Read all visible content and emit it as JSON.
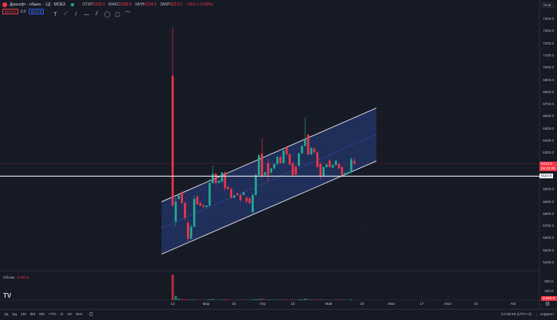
{
  "header": {
    "symbol": "Диасофт - обыкн. · 1Д · MOEX",
    "ohlc": {
      "o_label": "ОТКР",
      "o": "6235.0",
      "h_label": "МАКС",
      "h": "6269.5",
      "l_label": "МИН",
      "l": "6194.5",
      "c_label": "ЗАКР",
      "c": "6213.5",
      "change": "−39.5 (−0.63%)"
    },
    "bid": "6213.5",
    "spread": "0.0",
    "ask": "6213.5"
  },
  "toolbar": {
    "tools": [
      "text-tool",
      "brush-tool",
      "trend-line-tool",
      "horizontal-ray-tool",
      "parallel-channel-tool",
      "ellipse-tool",
      "rectangle-tool",
      "path-tool"
    ],
    "glyphs": [
      "T",
      "⟋",
      "/",
      "—",
      "⫽",
      "◯",
      "▢",
      "⌒"
    ]
  },
  "currency": "RUB",
  "price_axis": [
    "7400.0",
    "7300.0",
    "7200.0",
    "7100.0",
    "7000.0",
    "6900.0",
    "6800.0",
    "6700.0",
    "6600.0",
    "6500.0",
    "6400.0",
    "6300.0",
    "6000.0",
    "5900.0",
    "5800.0",
    "5700.0",
    "5600.0",
    "5500.0",
    "5400.0"
  ],
  "price_values": [
    7400,
    7300,
    7200,
    7100,
    7000,
    6900,
    6800,
    6700,
    6600,
    6500,
    6400,
    6300,
    6000,
    5900,
    5800,
    5700,
    5600,
    5500,
    5400
  ],
  "last_price": {
    "value": "6213.5",
    "countdown": "05:10:29"
  },
  "hline": {
    "label": "6110.5",
    "value": 6110.5
  },
  "volume": {
    "label": "Объём",
    "value": "3.203 K",
    "axis": [
      "800 K",
      "400 K"
    ],
    "last": "3.203 K"
  },
  "time_axis": [
    "13",
    "Мар",
    "18",
    "Апр",
    "15",
    "Май",
    "20",
    "Июн",
    "17",
    "Июл",
    "15",
    "Авг"
  ],
  "bottom": {
    "ranges": [
      "1д",
      "5д",
      "1М",
      "3М",
      "6М",
      "YTD",
      "1г",
      "5л",
      "Все"
    ],
    "clock": "13:49:29 (UTC+3)",
    "adjust": "коррект."
  },
  "colors": {
    "up": "#22ab94",
    "down": "#f23645",
    "channel": "#2a3f86"
  },
  "chart_data": {
    "type": "candlestick",
    "candles": [
      [
        6936,
        7330,
        5860,
        5869
      ],
      [
        5738,
        5935,
        5700,
        5902
      ],
      [
        5924,
        5960,
        5915,
        5950
      ],
      [
        5978,
        5990,
        5880,
        5891
      ],
      [
        5891,
        5900,
        5750,
        5767
      ],
      [
        5728,
        5745,
        5560,
        5597
      ],
      [
        5597,
        5710,
        5590,
        5695
      ],
      [
        5695,
        5950,
        5690,
        5924
      ],
      [
        5941,
        5955,
        5875,
        5880
      ],
      [
        5891,
        5900,
        5860,
        5869
      ],
      [
        5869,
        5880,
        5850,
        5858
      ],
      [
        5858,
        5875,
        5850,
        5869
      ],
      [
        5869,
        6090,
        5860,
        6054
      ],
      [
        6054,
        6200,
        6050,
        6130
      ],
      [
        6130,
        6140,
        6040,
        6054
      ],
      [
        6054,
        6080,
        6050,
        6072
      ],
      [
        6065,
        6145,
        6060,
        6141
      ],
      [
        6141,
        6150,
        5990,
        6011
      ],
      [
        6022,
        6030,
        5995,
        6006
      ],
      [
        6006,
        6015,
        5925,
        5934
      ],
      [
        5934,
        5960,
        5930,
        5952
      ],
      [
        5967,
        5980,
        5950,
        5956
      ],
      [
        5956,
        5965,
        5900,
        5913
      ],
      [
        5956,
        5985,
        5950,
        5978
      ],
      [
        5934,
        5945,
        5890,
        5902
      ],
      [
        5928,
        5935,
        5880,
        5891
      ],
      [
        5815,
        5970,
        5790,
        5956
      ],
      [
        5956,
        6130,
        5950,
        6120
      ],
      [
        6120,
        6290,
        6110,
        6283
      ],
      [
        6294,
        6420,
        6100,
        6109
      ],
      [
        6120,
        6150,
        6115,
        6141
      ],
      [
        6218,
        6250,
        6060,
        6120
      ],
      [
        6141,
        6180,
        6130,
        6174
      ],
      [
        6174,
        6215,
        6165,
        6211
      ],
      [
        6211,
        6275,
        6200,
        6268
      ],
      [
        6268,
        6280,
        6210,
        6218
      ],
      [
        6218,
        6330,
        6210,
        6320
      ],
      [
        6348,
        6360,
        6280,
        6290
      ],
      [
        6290,
        6300,
        6200,
        6207
      ],
      [
        6218,
        6225,
        6110,
        6120
      ],
      [
        6189,
        6200,
        6115,
        6124
      ],
      [
        6196,
        6305,
        6190,
        6298
      ],
      [
        6298,
        6365,
        6290,
        6359
      ],
      [
        6359,
        6590,
        6350,
        6414
      ],
      [
        6451,
        6460,
        6280,
        6290
      ],
      [
        6290,
        6350,
        6280,
        6342
      ],
      [
        6337,
        6345,
        6300,
        6305
      ],
      [
        6305,
        6315,
        6180,
        6185
      ],
      [
        6211,
        6230,
        6080,
        6115
      ],
      [
        6115,
        6190,
        6110,
        6185
      ],
      [
        6185,
        6215,
        6180,
        6207
      ],
      [
        6239,
        6250,
        6180,
        6185
      ],
      [
        6181,
        6210,
        6175,
        6202
      ],
      [
        6202,
        6245,
        6195,
        6239
      ],
      [
        6211,
        6220,
        6170,
        6174
      ],
      [
        6185,
        6190,
        6100,
        6120
      ],
      [
        6120,
        6140,
        6115,
        6137
      ],
      [
        6130,
        6150,
        6125,
        6141
      ],
      [
        6141,
        6265,
        6135,
        6250
      ],
      [
        6235,
        6269.5,
        6194.5,
        6213.5
      ]
    ],
    "volumes_k": [
      1070,
      180,
      60,
      40,
      30,
      25,
      20,
      35,
      20,
      15,
      18,
      15,
      40,
      45,
      20,
      15,
      25,
      30,
      15,
      12,
      12,
      10,
      15,
      20,
      12,
      15,
      35,
      40,
      45,
      60,
      20,
      30,
      20,
      18,
      20,
      15,
      25,
      22,
      18,
      20,
      15,
      30,
      35,
      60,
      40,
      20,
      18,
      25,
      30,
      18,
      15,
      20,
      12,
      15,
      18,
      22,
      15,
      12,
      30,
      3.2
    ],
    "channel": {
      "upper": [
        [
          0,
          5900
        ],
        [
          66,
          6670
        ]
      ],
      "lower": [
        [
          0,
          5470
        ],
        [
          66,
          6235
        ]
      ]
    }
  }
}
